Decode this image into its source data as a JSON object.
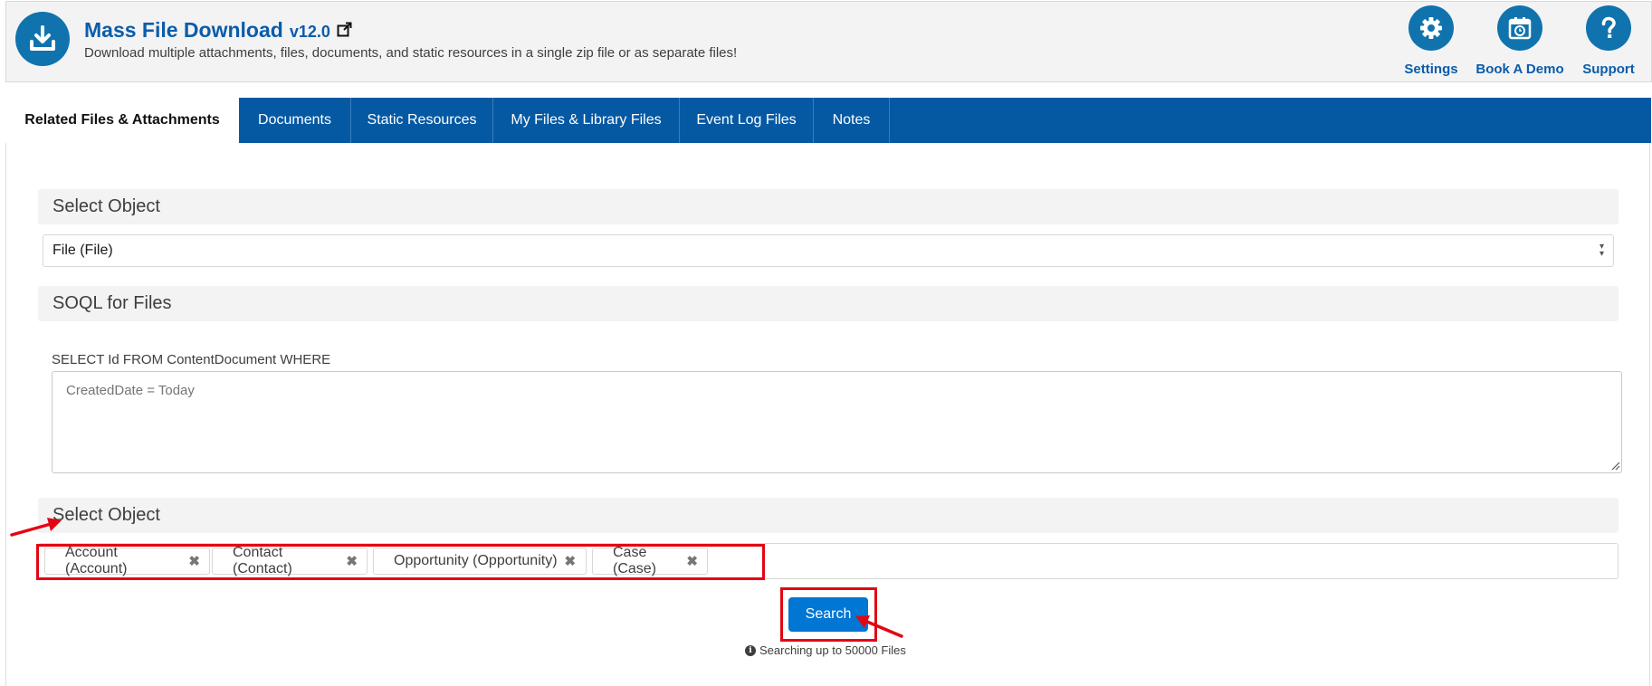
{
  "header": {
    "title": "Mass File Download",
    "version": "v12.0",
    "subtitle": "Download multiple attachments, files, documents, and static resources in a single zip file or as separate files!",
    "logo_icon": "download-icon",
    "buttons": [
      {
        "label": "Settings",
        "icon": "gear-icon"
      },
      {
        "label": "Book A Demo",
        "icon": "calendar-icon"
      },
      {
        "label": "Support",
        "icon": "question-icon"
      }
    ]
  },
  "tabs": [
    {
      "label": "Related Files & Attachments",
      "active": true
    },
    {
      "label": "Documents"
    },
    {
      "label": "Static Resources"
    },
    {
      "label": "My Files & Library Files"
    },
    {
      "label": "Event Log Files"
    },
    {
      "label": "Notes"
    }
  ],
  "object_section": {
    "title": "Select Object",
    "selected": "File (File)"
  },
  "soql_section": {
    "title": "SOQL for Files",
    "prefix": "SELECT Id FROM ContentDocument WHERE",
    "placeholder": "CreatedDate = Today"
  },
  "related_section": {
    "title": "Select Object",
    "selected_items": [
      "Account (Account)",
      "Contact (Contact)",
      "Opportunity (Opportunity)",
      "Case (Case)"
    ]
  },
  "search": {
    "button_label": "Search",
    "info_text": "Searching up to 50000 Files"
  },
  "colors": {
    "brand": "#1073ae",
    "tab_bar": "#0559a2",
    "primary_button": "#0176d3",
    "annotation": "#e30613"
  }
}
